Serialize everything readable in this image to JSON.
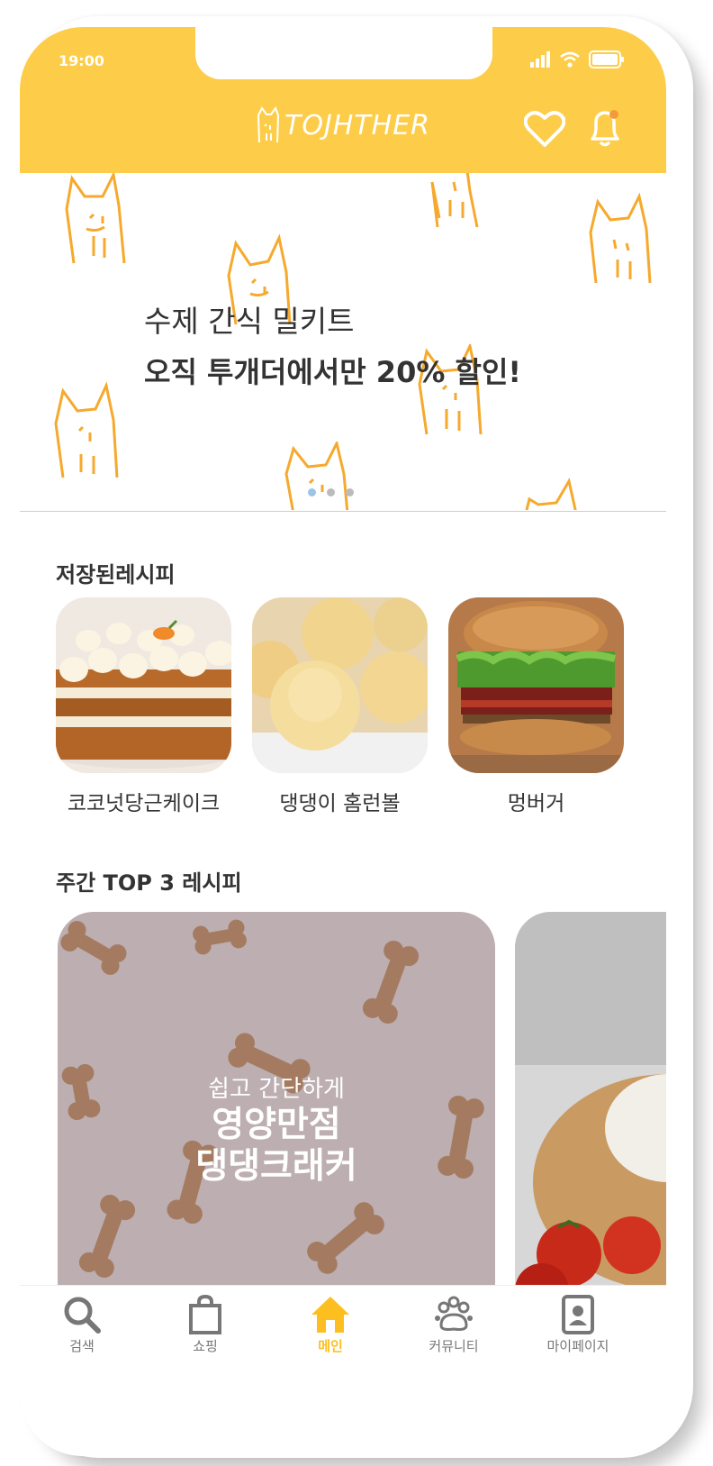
{
  "status_bar": {
    "time": "19:00"
  },
  "header": {
    "logo_text": "TOJHTHER"
  },
  "banner": {
    "line1": "수제 간식 밀키트",
    "line2": "오직 투개더에서만 20% 할인!",
    "active_dot": 0,
    "dot_count": 3
  },
  "saved": {
    "title": "저장된레시피",
    "items": [
      {
        "label": "코코넛당근케이크",
        "image": "carrot-cake"
      },
      {
        "label": "댕댕이 홈런볼",
        "image": "cream-puffs"
      },
      {
        "label": "멍버거",
        "image": "burger"
      }
    ]
  },
  "top3": {
    "title": "주간 TOP 3 레시피",
    "cards": [
      {
        "subtitle": "쉽고 간단하게",
        "title_line1": "영양만점",
        "title_line2": "댕댕크래커",
        "image": "bone-crackers"
      }
    ]
  },
  "tabbar": {
    "items": [
      {
        "label": "검색",
        "icon": "search-icon"
      },
      {
        "label": "쇼핑",
        "icon": "shopping-bag-icon"
      },
      {
        "label": "메인",
        "icon": "home-icon",
        "active": true
      },
      {
        "label": "커뮤니티",
        "icon": "paw-icon"
      },
      {
        "label": "마이페이지",
        "icon": "profile-icon"
      }
    ]
  },
  "colors": {
    "brand_yellow": "#fdcd49",
    "active_tab": "#fdbf1f",
    "cat_doodle": "#f6a92c"
  }
}
